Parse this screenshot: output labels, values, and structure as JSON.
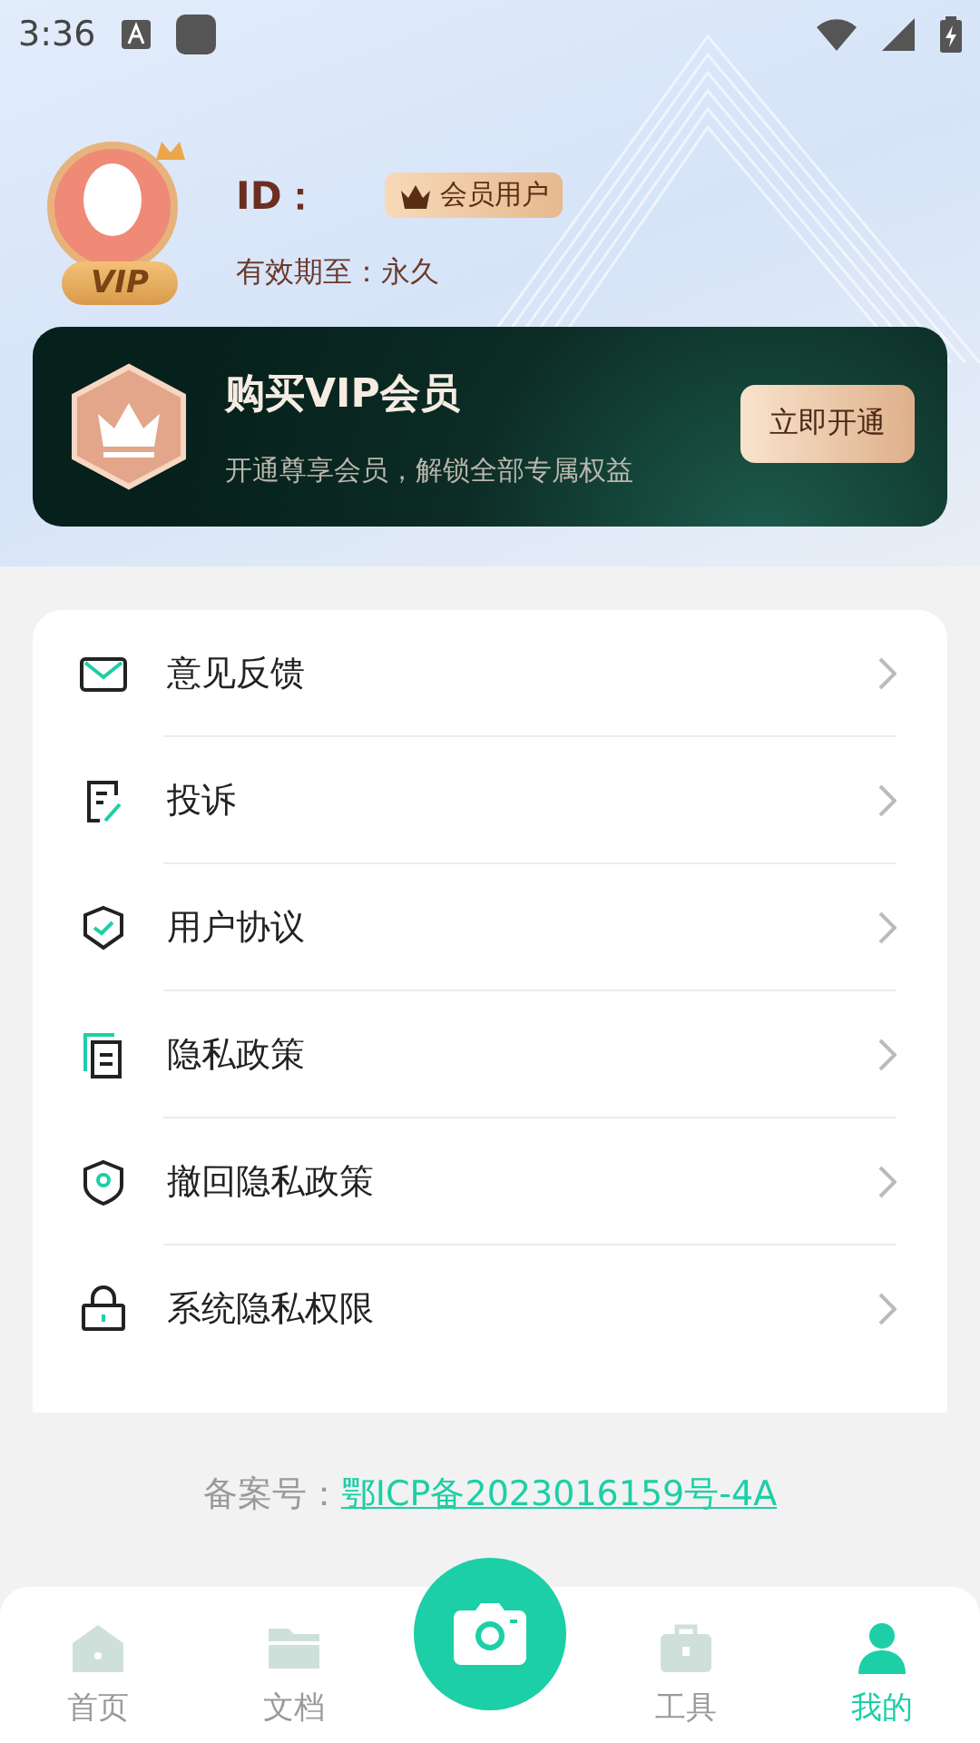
{
  "status_bar": {
    "time": "3:36"
  },
  "profile": {
    "avatar_badge": "VIP",
    "id_label": "ID：",
    "member_tag": "会员用户",
    "expiry": "有效期至：永久"
  },
  "vip_banner": {
    "title": "购买VIP会员",
    "subtitle": "开通尊享会员，解锁全部专属权益",
    "button": "立即开通"
  },
  "menu": [
    {
      "kind": "mail",
      "label": "意见反馈"
    },
    {
      "kind": "edit",
      "label": "投诉"
    },
    {
      "kind": "shield-check",
      "label": "用户协议"
    },
    {
      "kind": "document",
      "label": "隐私政策"
    },
    {
      "kind": "shield",
      "label": "撤回隐私政策"
    },
    {
      "kind": "lock",
      "label": "系统隐私权限"
    }
  ],
  "footer": {
    "label": "备案号：",
    "link": "鄂ICP备2023016159号-4A"
  },
  "bottom_nav": [
    {
      "kind": "home",
      "label": "首页",
      "selected": false
    },
    {
      "kind": "folder",
      "label": "文档",
      "selected": false
    },
    {
      "kind": "camera",
      "selected": false
    },
    {
      "kind": "toolbox",
      "label": "工具",
      "selected": false
    },
    {
      "kind": "person",
      "label": "我的",
      "selected": true
    }
  ]
}
